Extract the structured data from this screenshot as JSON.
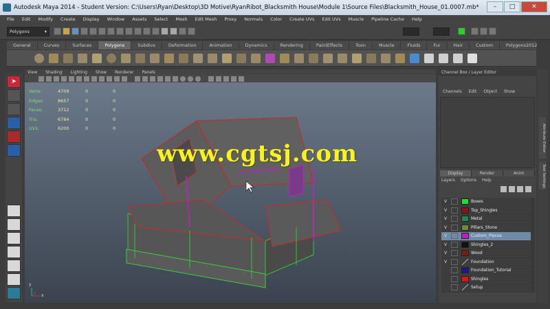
{
  "window": {
    "title": "Autodesk Maya 2014 - Student Version: C:\\Users\\Ryan\\Desktop\\3D Motive\\RyanRibot_Blacksmith House\\Module 1\\Source Files\\Blacksmith_House_01.0007.mb*",
    "minimize": "–",
    "maximize": "□",
    "close": "✕"
  },
  "menus": [
    "File",
    "Edit",
    "Modify",
    "Create",
    "Display",
    "Window",
    "Assets",
    "Select",
    "Mesh",
    "Edit Mesh",
    "Proxy",
    "Normals",
    "Color",
    "Create UVs",
    "Edit UVs",
    "Muscle",
    "Pipeline Cache",
    "Help"
  ],
  "statusline": {
    "mode": "Polygons"
  },
  "shelf_tabs": [
    "General",
    "Curves",
    "Surfaces",
    "Polygons",
    "Subdivs",
    "Deformation",
    "Animation",
    "Dynamics",
    "Rendering",
    "PaintEffects",
    "Toon",
    "Muscle",
    "Fluids",
    "Fur",
    "Hair",
    "Custom",
    "Polygons2012"
  ],
  "active_shelf": "Polygons",
  "viewport": {
    "menu": [
      "View",
      "Shading",
      "Lighting",
      "Show",
      "Renderer",
      "Panels"
    ],
    "hud": [
      {
        "label": "Verts:",
        "value": "4709",
        "a": "0",
        "b": "0"
      },
      {
        "label": "Edges:",
        "value": "8657",
        "a": "0",
        "b": "0"
      },
      {
        "label": "Faces:",
        "value": "3712",
        "a": "0",
        "b": "0"
      },
      {
        "label": "Tris:",
        "value": "6784",
        "a": "0",
        "b": "0"
      },
      {
        "label": "UVs:",
        "value": "6200",
        "a": "0",
        "b": "0"
      }
    ],
    "watermark": "www.cgtsj.com",
    "axis_x": "x",
    "axis_y": "y"
  },
  "channel_box": {
    "title": "Channel Box / Layer Editor",
    "menu": [
      "Channels",
      "Edit",
      "Object",
      "Show"
    ]
  },
  "layer_editor": {
    "tabs": [
      "Display",
      "Render",
      "Anim"
    ],
    "active_tab": "Display",
    "menu": [
      "Layers",
      "Options",
      "Help"
    ],
    "layers": [
      {
        "v": "V",
        "name": "Boxes",
        "color": "#1fe02a",
        "selected": false
      },
      {
        "v": "V",
        "name": "Top_Shingles",
        "color": "#8c1414",
        "selected": false
      },
      {
        "v": "V",
        "name": "Metal",
        "color": "#1f8a4a",
        "selected": false
      },
      {
        "v": "V",
        "name": "Pillars_Stone",
        "color": "#6e8a3a",
        "selected": false
      },
      {
        "v": "V",
        "name": "Custom_Pieces",
        "color": "#c01fc0",
        "selected": true
      },
      {
        "v": "V",
        "name": "Shingles_2",
        "color": "#111111",
        "selected": false
      },
      {
        "v": "V",
        "name": "Wood",
        "color": "#7a1a1a",
        "selected": false
      },
      {
        "v": "V",
        "name": "Foundation",
        "color": "diag",
        "selected": false
      },
      {
        "v": "",
        "name": "Foundation_Tutorial",
        "color": "#1a1a8c",
        "selected": false
      },
      {
        "v": "",
        "name": "Shingles",
        "color": "#e01414",
        "selected": false
      },
      {
        "v": "",
        "name": "Setup",
        "color": "diag",
        "selected": false
      }
    ]
  },
  "side_tabs": [
    "Channel Box / Layer Editor",
    "Attribute Editor",
    "Tool Settings"
  ]
}
